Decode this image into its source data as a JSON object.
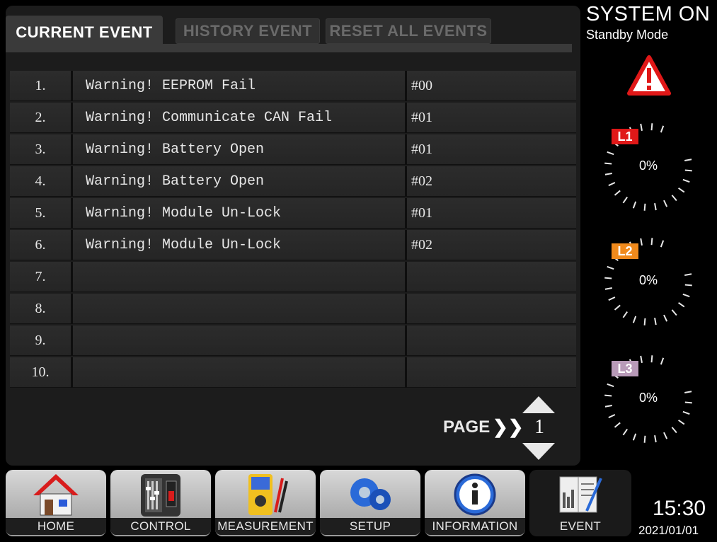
{
  "tabs": {
    "current": "CURRENT EVENT",
    "history": "HISTORY EVENT",
    "reset": "RESET ALL EVENTS"
  },
  "events": [
    {
      "num": "1.",
      "msg": "Warning! EEPROM Fail",
      "code": "#00"
    },
    {
      "num": "2.",
      "msg": "Warning! Communicate CAN Fail",
      "code": "#01"
    },
    {
      "num": "3.",
      "msg": "Warning! Battery Open",
      "code": "#01"
    },
    {
      "num": "4.",
      "msg": "Warning! Battery Open",
      "code": "#02"
    },
    {
      "num": "5.",
      "msg": "Warning! Module Un-Lock",
      "code": "#01"
    },
    {
      "num": "6.",
      "msg": "Warning! Module Un-Lock",
      "code": "#02"
    },
    {
      "num": "7.",
      "msg": "",
      "code": ""
    },
    {
      "num": "8.",
      "msg": "",
      "code": ""
    },
    {
      "num": "9.",
      "msg": "",
      "code": ""
    },
    {
      "num": "10.",
      "msg": "",
      "code": ""
    }
  ],
  "pager": {
    "label": "PAGE",
    "chevron": "❯❯",
    "page": "1"
  },
  "status": {
    "system": "SYSTEM ON",
    "mode": "Standby Mode"
  },
  "gauges": [
    {
      "label": "L1",
      "value": "0%",
      "color": "#e01818"
    },
    {
      "label": "L2",
      "value": "0%",
      "color": "#f08a1c"
    },
    {
      "label": "L3",
      "value": "0%",
      "color": "#b89ab8"
    }
  ],
  "nav": {
    "home": "HOME",
    "control": "CONTROL",
    "measurement": "MEASUREMENT",
    "setup": "SETUP",
    "information": "INFORMATION",
    "event": "EVENT"
  },
  "clock": {
    "time": "15:30",
    "date": "2021/01/01"
  }
}
